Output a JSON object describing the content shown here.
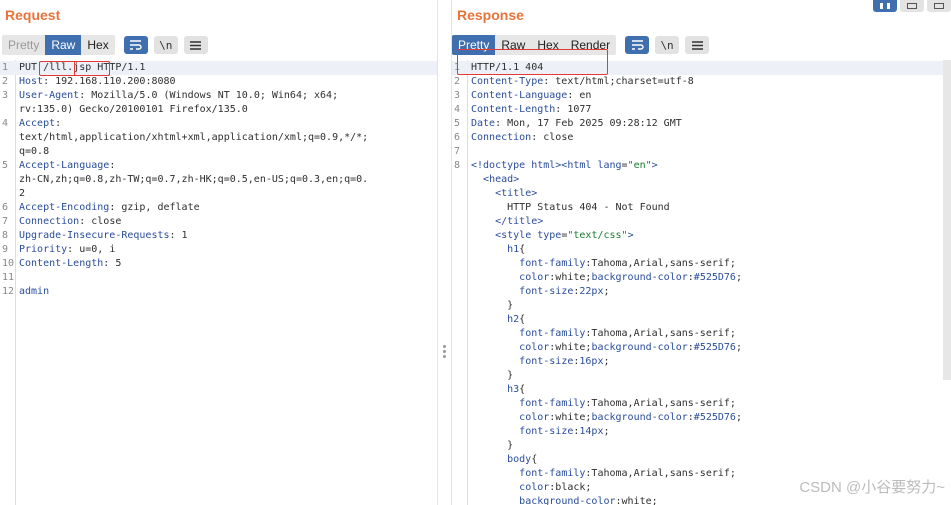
{
  "request": {
    "title": "Request",
    "tabs": [
      "Pretty",
      "Raw",
      "Hex"
    ],
    "active_tab": "Raw",
    "lines": [
      {
        "n": "1",
        "segs": [
          [
            "t",
            "PUT "
          ],
          [
            "t",
            "/lll.jsp"
          ],
          [
            "t",
            " HTTP/1.1"
          ]
        ]
      },
      {
        "n": "2",
        "segs": [
          [
            "k",
            "Host"
          ],
          [
            "t",
            ": 192.168.110.200:8080"
          ]
        ]
      },
      {
        "n": "3",
        "segs": [
          [
            "k",
            "User-Agent"
          ],
          [
            "t",
            ": Mozilla/5.0 (Windows NT 10.0; Win64; x64;"
          ]
        ]
      },
      {
        "n": "",
        "segs": [
          [
            "t",
            "rv:135.0) Gecko/20100101 Firefox/135.0"
          ]
        ]
      },
      {
        "n": "4",
        "segs": [
          [
            "k",
            "Accept"
          ],
          [
            "t",
            ":"
          ]
        ]
      },
      {
        "n": "",
        "segs": [
          [
            "t",
            "text/html,application/xhtml+xml,application/xml;q=0.9,*/*;"
          ]
        ]
      },
      {
        "n": "",
        "segs": [
          [
            "t",
            "q=0.8"
          ]
        ]
      },
      {
        "n": "5",
        "segs": [
          [
            "k",
            "Accept-Language"
          ],
          [
            "t",
            ":"
          ]
        ]
      },
      {
        "n": "",
        "segs": [
          [
            "t",
            "zh-CN,zh;q=0.8,zh-TW;q=0.7,zh-HK;q=0.5,en-US;q=0.3,en;q=0."
          ]
        ]
      },
      {
        "n": "",
        "segs": [
          [
            "t",
            "2"
          ]
        ]
      },
      {
        "n": "6",
        "segs": [
          [
            "k",
            "Accept-Encoding"
          ],
          [
            "t",
            ": gzip, deflate"
          ]
        ]
      },
      {
        "n": "7",
        "segs": [
          [
            "k",
            "Connection"
          ],
          [
            "t",
            ": close"
          ]
        ]
      },
      {
        "n": "8",
        "segs": [
          [
            "k",
            "Upgrade-Insecure-Requests"
          ],
          [
            "t",
            ": 1"
          ]
        ]
      },
      {
        "n": "9",
        "segs": [
          [
            "k",
            "Priority"
          ],
          [
            "t",
            ": u=0, i"
          ]
        ]
      },
      {
        "n": "10",
        "segs": [
          [
            "k",
            "Content-Length"
          ],
          [
            "t",
            ": 5"
          ]
        ]
      },
      {
        "n": "11",
        "segs": []
      },
      {
        "n": "12",
        "segs": [
          [
            "k",
            "admin"
          ]
        ]
      }
    ]
  },
  "response": {
    "title": "Response",
    "tabs": [
      "Pretty",
      "Raw",
      "Hex",
      "Render"
    ],
    "active_tab": "Pretty",
    "lines": [
      {
        "n": "1",
        "segs": [
          [
            "t",
            "HTTP/1.1 404"
          ]
        ]
      },
      {
        "n": "2",
        "segs": [
          [
            "k",
            "Content-Type"
          ],
          [
            "t",
            ": text/html;charset=utf-8"
          ]
        ]
      },
      {
        "n": "3",
        "segs": [
          [
            "k",
            "Content-Language"
          ],
          [
            "t",
            ": en"
          ]
        ]
      },
      {
        "n": "4",
        "segs": [
          [
            "k",
            "Content-Length"
          ],
          [
            "t",
            ": 1077"
          ]
        ]
      },
      {
        "n": "5",
        "segs": [
          [
            "k",
            "Date"
          ],
          [
            "t",
            ": Mon, 17 Feb 2025 09:28:12 GMT"
          ]
        ]
      },
      {
        "n": "6",
        "segs": [
          [
            "k",
            "Connection"
          ],
          [
            "t",
            ": close"
          ]
        ]
      },
      {
        "n": "7",
        "segs": []
      },
      {
        "n": "8",
        "segs": [
          [
            "tag",
            "<!doctype html><html "
          ],
          [
            "k",
            "lang"
          ],
          [
            "t",
            "="
          ],
          [
            "str",
            "\"en\""
          ],
          [
            "tag",
            ">"
          ]
        ]
      },
      {
        "n": "",
        "segs": [
          [
            "t",
            "  "
          ],
          [
            "tag",
            "<head>"
          ]
        ]
      },
      {
        "n": "",
        "segs": [
          [
            "t",
            "    "
          ],
          [
            "tag",
            "<title>"
          ]
        ]
      },
      {
        "n": "",
        "segs": [
          [
            "t",
            "      HTTP Status 404 - Not Found"
          ]
        ]
      },
      {
        "n": "",
        "segs": [
          [
            "t",
            "    "
          ],
          [
            "tag",
            "</title>"
          ]
        ]
      },
      {
        "n": "",
        "segs": [
          [
            "t",
            "    "
          ],
          [
            "tag",
            "<style "
          ],
          [
            "k",
            "type"
          ],
          [
            "t",
            "="
          ],
          [
            "str",
            "\"text/css\""
          ],
          [
            "tag",
            ">"
          ]
        ]
      },
      {
        "n": "",
        "segs": [
          [
            "t",
            "      "
          ],
          [
            "k",
            "h1"
          ],
          [
            "t",
            "{"
          ]
        ]
      },
      {
        "n": "",
        "segs": [
          [
            "t",
            "        "
          ],
          [
            "k",
            "font-family"
          ],
          [
            "t",
            ":Tahoma,Arial,sans-serif;"
          ]
        ]
      },
      {
        "n": "",
        "segs": [
          [
            "t",
            "        "
          ],
          [
            "k",
            "color"
          ],
          [
            "t",
            ":white;"
          ],
          [
            "k",
            "background-color"
          ],
          [
            "t",
            ":"
          ],
          [
            "k",
            "#525D76"
          ],
          [
            "t",
            ";"
          ]
        ]
      },
      {
        "n": "",
        "segs": [
          [
            "t",
            "        "
          ],
          [
            "k",
            "font-size"
          ],
          [
            "t",
            ":"
          ],
          [
            "k",
            "22px"
          ],
          [
            "t",
            ";"
          ]
        ]
      },
      {
        "n": "",
        "segs": [
          [
            "t",
            "      }"
          ]
        ]
      },
      {
        "n": "",
        "segs": [
          [
            "t",
            "      "
          ],
          [
            "k",
            "h2"
          ],
          [
            "t",
            "{"
          ]
        ]
      },
      {
        "n": "",
        "segs": [
          [
            "t",
            "        "
          ],
          [
            "k",
            "font-family"
          ],
          [
            "t",
            ":Tahoma,Arial,sans-serif;"
          ]
        ]
      },
      {
        "n": "",
        "segs": [
          [
            "t",
            "        "
          ],
          [
            "k",
            "color"
          ],
          [
            "t",
            ":white;"
          ],
          [
            "k",
            "background-color"
          ],
          [
            "t",
            ":"
          ],
          [
            "k",
            "#525D76"
          ],
          [
            "t",
            ";"
          ]
        ]
      },
      {
        "n": "",
        "segs": [
          [
            "t",
            "        "
          ],
          [
            "k",
            "font-size"
          ],
          [
            "t",
            ":"
          ],
          [
            "k",
            "16px"
          ],
          [
            "t",
            ";"
          ]
        ]
      },
      {
        "n": "",
        "segs": [
          [
            "t",
            "      }"
          ]
        ]
      },
      {
        "n": "",
        "segs": [
          [
            "t",
            "      "
          ],
          [
            "k",
            "h3"
          ],
          [
            "t",
            "{"
          ]
        ]
      },
      {
        "n": "",
        "segs": [
          [
            "t",
            "        "
          ],
          [
            "k",
            "font-family"
          ],
          [
            "t",
            ":Tahoma,Arial,sans-serif;"
          ]
        ]
      },
      {
        "n": "",
        "segs": [
          [
            "t",
            "        "
          ],
          [
            "k",
            "color"
          ],
          [
            "t",
            ":white;"
          ],
          [
            "k",
            "background-color"
          ],
          [
            "t",
            ":"
          ],
          [
            "k",
            "#525D76"
          ],
          [
            "t",
            ";"
          ]
        ]
      },
      {
        "n": "",
        "segs": [
          [
            "t",
            "        "
          ],
          [
            "k",
            "font-size"
          ],
          [
            "t",
            ":"
          ],
          [
            "k",
            "14px"
          ],
          [
            "t",
            ";"
          ]
        ]
      },
      {
        "n": "",
        "segs": [
          [
            "t",
            "      }"
          ]
        ]
      },
      {
        "n": "",
        "segs": [
          [
            "t",
            "      "
          ],
          [
            "k",
            "body"
          ],
          [
            "t",
            "{"
          ]
        ]
      },
      {
        "n": "",
        "segs": [
          [
            "t",
            "        "
          ],
          [
            "k",
            "font-family"
          ],
          [
            "t",
            ":Tahoma,Arial,sans-serif;"
          ]
        ]
      },
      {
        "n": "",
        "segs": [
          [
            "t",
            "        "
          ],
          [
            "k",
            "color"
          ],
          [
            "t",
            ":black;"
          ]
        ]
      },
      {
        "n": "",
        "segs": [
          [
            "t",
            "        "
          ],
          [
            "k",
            "background-color"
          ],
          [
            "t",
            ":white;"
          ]
        ]
      }
    ]
  },
  "toolbar_icons": [
    "wrap-icon",
    "newline-icon",
    "menu-icon"
  ],
  "newline_glyph": "\\n",
  "watermark": "CSDN @小谷要努力~",
  "colors": {
    "accent": "#e8743b",
    "active_tab": "#3f6fae",
    "highlight_box": "#e53935"
  }
}
